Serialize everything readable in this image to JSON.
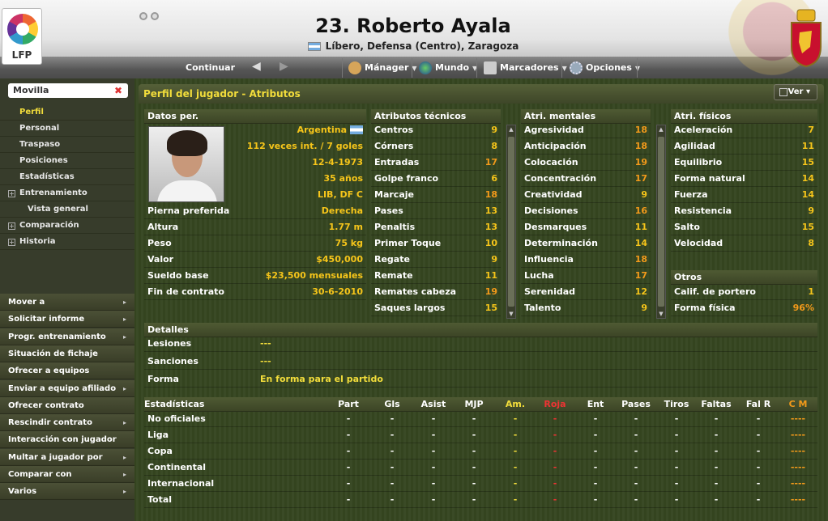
{
  "header": {
    "title": "23. Roberto Ayala",
    "subtitle": "Líbero, Defensa (Centro), Zaragoza",
    "logo_text": "LFP"
  },
  "nav_bar": {
    "continuar": "Continuar",
    "menus": [
      "Mánager",
      "Mundo",
      "Marcadores",
      "Opciones"
    ]
  },
  "sidebar": {
    "search_value": "Movilla",
    "items": [
      {
        "label": "Perfil",
        "active": true
      },
      {
        "label": "Personal"
      },
      {
        "label": "Traspaso"
      },
      {
        "label": "Posiciones"
      },
      {
        "label": "Estadísticas"
      },
      {
        "label": "Entrenamiento",
        "expand": true
      },
      {
        "label": "Vista general",
        "sub": true
      },
      {
        "label": "Comparación",
        "expand": true
      },
      {
        "label": "Historia",
        "expand": true
      }
    ],
    "actions": [
      {
        "label": "Mover a",
        "arrow": true
      },
      {
        "label": "Solicitar informe",
        "arrow": true
      },
      {
        "label": "Progr. entrenamiento",
        "arrow": true
      },
      {
        "label": "Situación de fichaje",
        "arrow": false
      },
      {
        "label": "Ofrecer a equipos",
        "arrow": false
      },
      {
        "label": "Enviar a equipo afiliado",
        "arrow": true
      },
      {
        "label": "Ofrecer contrato",
        "arrow": false
      },
      {
        "label": "Rescindir contrato",
        "arrow": true
      },
      {
        "label": "Interacción con jugador",
        "arrow": false
      },
      {
        "label": "Multar a jugador por",
        "arrow": true
      },
      {
        "label": "Comparar con",
        "arrow": true
      },
      {
        "label": "Varios",
        "arrow": true
      }
    ]
  },
  "panel": {
    "title": "Perfil del jugador - Atributos",
    "ver": "Ver"
  },
  "personal": {
    "header": "Datos per.",
    "top": [
      "Argentina",
      "112 veces int. / 7 goles",
      "12-4-1973",
      "35 años",
      "LIB, DF C"
    ],
    "rows": [
      {
        "label": "Pierna preferida",
        "value": "Derecha"
      },
      {
        "label": "Altura",
        "value": "1.77 m"
      },
      {
        "label": "Peso",
        "value": "75 kg"
      },
      {
        "label": "Valor",
        "value": "$450,000"
      },
      {
        "label": "Sueldo base",
        "value": "$23,500 mensuales"
      },
      {
        "label": "Fin de contrato",
        "value": "30-6-2010"
      }
    ]
  },
  "tecnicos": {
    "header": "Atributos técnicos",
    "rows": [
      {
        "label": "Centros",
        "value": "9"
      },
      {
        "label": "Córners",
        "value": "8"
      },
      {
        "label": "Entradas",
        "value": "17"
      },
      {
        "label": "Golpe franco",
        "value": "6"
      },
      {
        "label": "Marcaje",
        "value": "18"
      },
      {
        "label": "Pases",
        "value": "13"
      },
      {
        "label": "Penaltis",
        "value": "13"
      },
      {
        "label": "Primer Toque",
        "value": "10"
      },
      {
        "label": "Regate",
        "value": "9"
      },
      {
        "label": "Remate",
        "value": "11"
      },
      {
        "label": "Remates cabeza",
        "value": "19"
      },
      {
        "label": "Saques largos",
        "value": "15"
      }
    ]
  },
  "mentales": {
    "header": "Atri. mentales",
    "rows": [
      {
        "label": "Agresividad",
        "value": "18"
      },
      {
        "label": "Anticipación",
        "value": "18"
      },
      {
        "label": "Colocación",
        "value": "19"
      },
      {
        "label": "Concentración",
        "value": "17"
      },
      {
        "label": "Creatividad",
        "value": "9"
      },
      {
        "label": "Decisiones",
        "value": "16"
      },
      {
        "label": "Desmarques",
        "value": "11"
      },
      {
        "label": "Determinación",
        "value": "14"
      },
      {
        "label": "Influencia",
        "value": "18"
      },
      {
        "label": "Lucha",
        "value": "17"
      },
      {
        "label": "Serenidad",
        "value": "12"
      },
      {
        "label": "Talento",
        "value": "9"
      }
    ]
  },
  "fisicos": {
    "header": "Atri. físicos",
    "rows": [
      {
        "label": "Aceleración",
        "value": "7"
      },
      {
        "label": "Agilidad",
        "value": "11"
      },
      {
        "label": "Equilibrio",
        "value": "15"
      },
      {
        "label": "Forma natural",
        "value": "14"
      },
      {
        "label": "Fuerza",
        "value": "14"
      },
      {
        "label": "Resistencia",
        "value": "9"
      },
      {
        "label": "Salto",
        "value": "15"
      },
      {
        "label": "Velocidad",
        "value": "8"
      }
    ]
  },
  "otros": {
    "header": "Otros",
    "rows": [
      {
        "label": "Calif. de portero",
        "value": "1"
      },
      {
        "label": "Forma física",
        "value": "96%"
      }
    ]
  },
  "detalles": {
    "header": "Detalles",
    "rows": [
      {
        "label": "Lesiones",
        "value": "---"
      },
      {
        "label": "Sanciones",
        "value": "---"
      },
      {
        "label": "Forma",
        "value": "En forma para el partido"
      }
    ]
  },
  "estadisticas": {
    "columns": [
      "Estadísticas",
      "Part",
      "Gls",
      "Asist",
      "MJP",
      "Am.",
      "Roja",
      "Ent",
      "Pases",
      "Tiros",
      "Faltas",
      "Fal R",
      "C M"
    ],
    "rows": [
      {
        "label": "No oficiales",
        "cells": [
          "-",
          "-",
          "-",
          "-",
          "-",
          "-",
          "-",
          "-",
          "-",
          "-",
          "-",
          "----"
        ]
      },
      {
        "label": "Liga",
        "cells": [
          "-",
          "-",
          "-",
          "-",
          "-",
          "-",
          "-",
          "-",
          "-",
          "-",
          "-",
          "----"
        ]
      },
      {
        "label": "Copa",
        "cells": [
          "-",
          "-",
          "-",
          "-",
          "-",
          "-",
          "-",
          "-",
          "-",
          "-",
          "-",
          "----"
        ]
      },
      {
        "label": "Continental",
        "cells": [
          "-",
          "-",
          "-",
          "-",
          "-",
          "-",
          "-",
          "-",
          "-",
          "-",
          "-",
          "----"
        ]
      },
      {
        "label": "Internacional",
        "cells": [
          "-",
          "-",
          "-",
          "-",
          "-",
          "-",
          "-",
          "-",
          "-",
          "-",
          "-",
          "----"
        ]
      },
      {
        "label": "Total",
        "cells": [
          "-",
          "-",
          "-",
          "-",
          "-",
          "-",
          "-",
          "-",
          "-",
          "-",
          "-",
          "----"
        ]
      }
    ]
  }
}
